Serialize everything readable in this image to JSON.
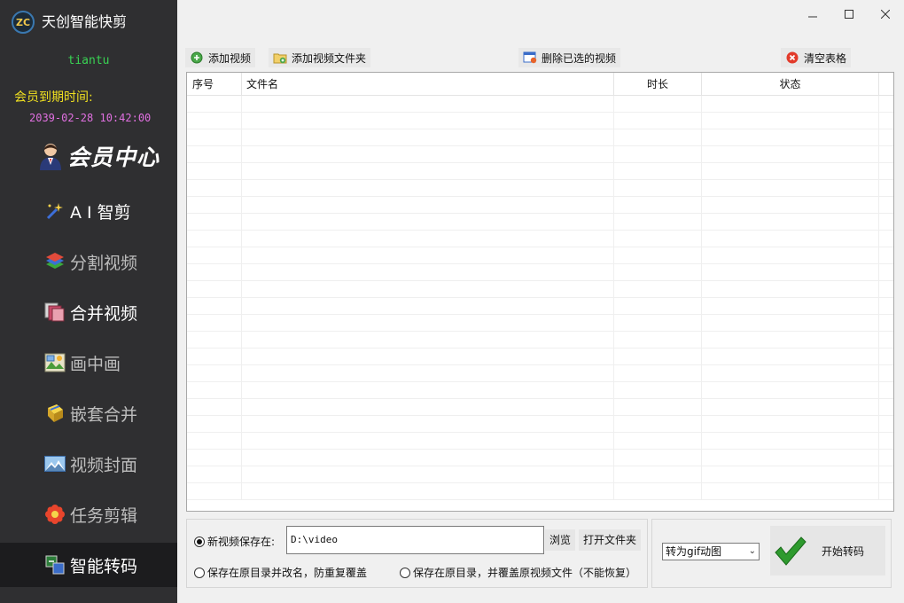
{
  "app": {
    "logo_text": "ZC",
    "title": "天创智能快剪"
  },
  "user": {
    "name": "tiantu",
    "expiry_label": "会员到期时间:",
    "expiry_value": "2039-02-28 10:42:00",
    "vip_label": "会员中心"
  },
  "sidebar": {
    "items": [
      {
        "label": "A I 智剪"
      },
      {
        "label": "分割视频"
      },
      {
        "label": "合并视频"
      },
      {
        "label": "画中画"
      },
      {
        "label": "嵌套合并"
      },
      {
        "label": "视频封面"
      },
      {
        "label": "任务剪辑"
      },
      {
        "label": "智能转码"
      }
    ]
  },
  "window": {
    "minimize": "—",
    "maximize": "□",
    "close": "✕"
  },
  "toolbar": {
    "add_video": "添加视频",
    "add_folder": "添加视频文件夹",
    "delete_selected": "删除已选的视频",
    "clear_table": "清空表格"
  },
  "table": {
    "columns": [
      "序号",
      "文件名",
      "时长",
      "状态"
    ],
    "rows": []
  },
  "output": {
    "save_new_label": "新视频保存在:",
    "path_value": "D:\\video",
    "browse": "浏览",
    "open_folder": "打开文件夹",
    "save_rename_label": "保存在原目录并改名，防重复覆盖",
    "save_overwrite_label": "保存在原目录，并覆盖原视频文件（不能恢复）",
    "selected_option": "save_new"
  },
  "convert": {
    "format_selected": "转为gif动图",
    "start_label": "开始转码"
  },
  "colors": {
    "sidebar_bg": "#2f2f31",
    "active_bg": "#1c1c1e",
    "username": "#39d353",
    "expiry_label": "#f0e020",
    "expiry_value": "#e070e0"
  }
}
